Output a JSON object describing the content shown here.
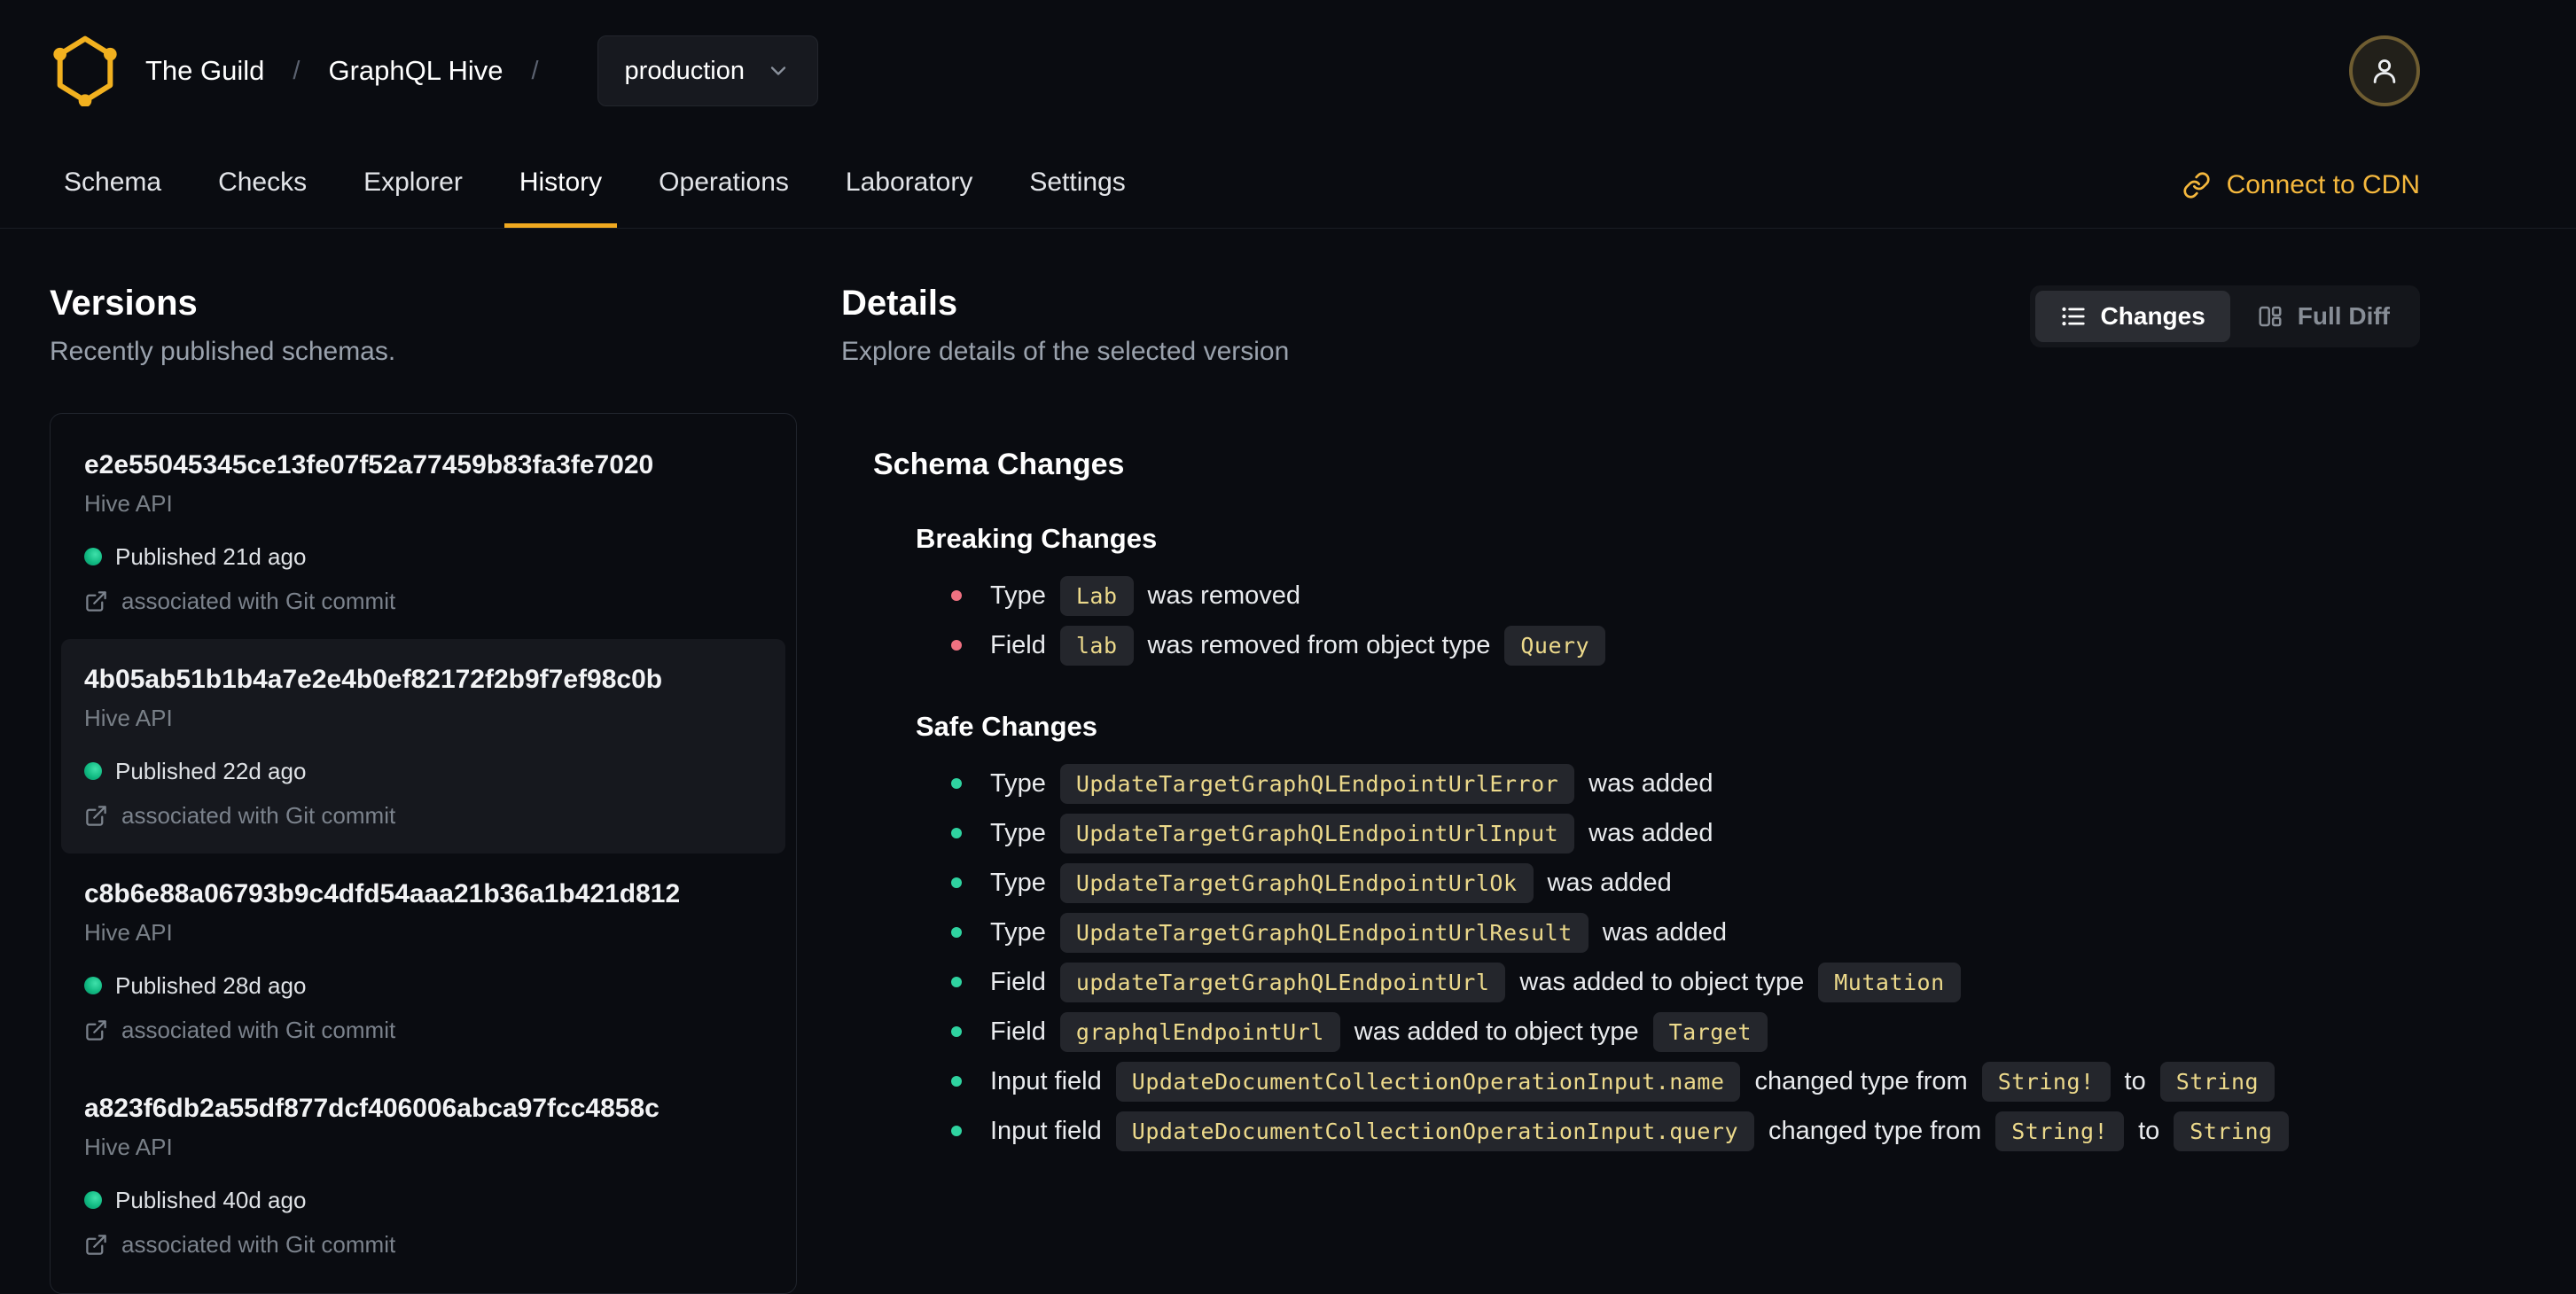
{
  "header": {
    "org": "The Guild",
    "separator": "/",
    "project": "GraphQL Hive",
    "target": "production"
  },
  "nav": {
    "tabs": [
      {
        "label": "Schema",
        "active": false
      },
      {
        "label": "Checks",
        "active": false
      },
      {
        "label": "Explorer",
        "active": false
      },
      {
        "label": "History",
        "active": true
      },
      {
        "label": "Operations",
        "active": false
      },
      {
        "label": "Laboratory",
        "active": false
      },
      {
        "label": "Settings",
        "active": false
      }
    ],
    "cdn_link": "Connect to CDN"
  },
  "versions": {
    "title": "Versions",
    "subtitle": "Recently published schemas.",
    "items": [
      {
        "hash": "e2e55045345ce13fe07f52a77459b83fa3fe7020",
        "service": "Hive API",
        "published": "Published 21d ago",
        "git": "associated with Git commit",
        "selected": false
      },
      {
        "hash": "4b05ab51b1b4a7e2e4b0ef82172f2b9f7ef98c0b",
        "service": "Hive API",
        "published": "Published 22d ago",
        "git": "associated with Git commit",
        "selected": true
      },
      {
        "hash": "c8b6e88a06793b9c4dfd54aaa21b36a1b421d812",
        "service": "Hive API",
        "published": "Published 28d ago",
        "git": "associated with Git commit",
        "selected": false
      },
      {
        "hash": "a823f6db2a55df877dcf406006abca97fcc4858c",
        "service": "Hive API",
        "published": "Published 40d ago",
        "git": "associated with Git commit",
        "selected": false
      }
    ]
  },
  "details": {
    "title": "Details",
    "subtitle": "Explore details of the selected version",
    "view_toggle": [
      {
        "label": "Changes",
        "icon": "list-icon",
        "active": true
      },
      {
        "label": "Full Diff",
        "icon": "columns-icon",
        "active": false
      }
    ],
    "schema_changes_title": "Schema Changes",
    "sections": [
      {
        "title": "Breaking Changes",
        "bullet_color": "#ef7181",
        "items": [
          [
            {
              "t": "Type"
            },
            {
              "c": "Lab"
            },
            {
              "t": "was removed"
            }
          ],
          [
            {
              "t": "Field"
            },
            {
              "c": "lab"
            },
            {
              "t": "was removed from object type"
            },
            {
              "c": "Query"
            }
          ]
        ]
      },
      {
        "title": "Safe Changes",
        "bullet_color": "#2fd3a0",
        "items": [
          [
            {
              "t": "Type"
            },
            {
              "c": "UpdateTargetGraphQLEndpointUrlError"
            },
            {
              "t": "was added"
            }
          ],
          [
            {
              "t": "Type"
            },
            {
              "c": "UpdateTargetGraphQLEndpointUrlInput"
            },
            {
              "t": "was added"
            }
          ],
          [
            {
              "t": "Type"
            },
            {
              "c": "UpdateTargetGraphQLEndpointUrlOk"
            },
            {
              "t": "was added"
            }
          ],
          [
            {
              "t": "Type"
            },
            {
              "c": "UpdateTargetGraphQLEndpointUrlResult"
            },
            {
              "t": "was added"
            }
          ],
          [
            {
              "t": "Field"
            },
            {
              "c": "updateTargetGraphQLEndpointUrl"
            },
            {
              "t": "was added to object type"
            },
            {
              "c": "Mutation"
            }
          ],
          [
            {
              "t": "Field"
            },
            {
              "c": "graphqlEndpointUrl"
            },
            {
              "t": "was added to object type"
            },
            {
              "c": "Target"
            }
          ],
          [
            {
              "t": "Input field"
            },
            {
              "c": "UpdateDocumentCollectionOperationInput.name"
            },
            {
              "t": "changed type from"
            },
            {
              "c": "String!"
            },
            {
              "t": "to"
            },
            {
              "c": "String"
            }
          ],
          [
            {
              "t": "Input field"
            },
            {
              "c": "UpdateDocumentCollectionOperationInput.query"
            },
            {
              "t": "changed type from"
            },
            {
              "c": "String!"
            },
            {
              "t": "to"
            },
            {
              "c": "String"
            }
          ]
        ]
      }
    ]
  },
  "colors": {
    "background": "#0a0c11",
    "brand_yellow": "#f2b11f",
    "link_yellow": "#f5b83d",
    "tab_underline": "#f0a920",
    "code_text": "#ecd98b",
    "code_background": "#24262c",
    "breaking_bullet": "#ef7181",
    "safe_bullet": "#2fd3a0",
    "published_dot": "#10b981",
    "selected_card": "#16181e"
  }
}
